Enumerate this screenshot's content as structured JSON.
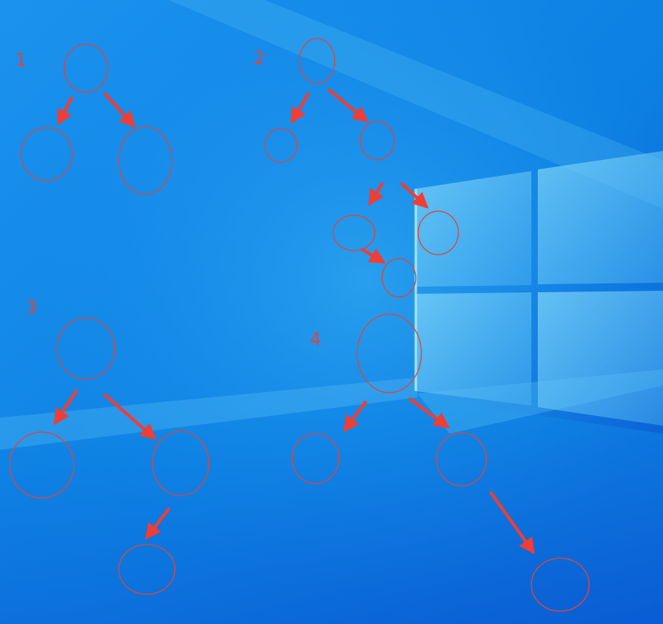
{
  "wallpaper": {
    "name": "windows-10-hero-wallpaper",
    "colors": {
      "base": "#0e7fe6",
      "light": "#35b7f4",
      "dark": "#0a4fc8",
      "pane": "#5fc6f5",
      "mullion": "#0b5fd1"
    }
  },
  "annotation": {
    "stroke_color": "#d9473f",
    "arrow_color": "#ee3e36"
  },
  "labels": {
    "d1": "1",
    "d2": "2",
    "d3": "3",
    "d4": "4"
  }
}
